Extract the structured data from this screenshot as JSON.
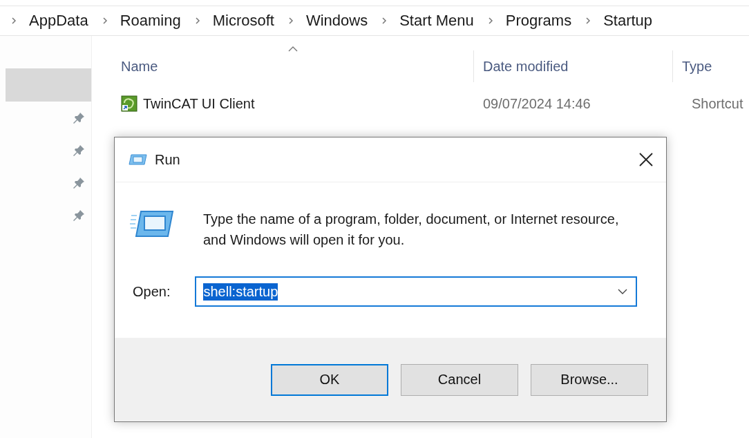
{
  "breadcrumb": [
    "AppData",
    "Roaming",
    "Microsoft",
    "Windows",
    "Start Menu",
    "Programs",
    "Startup"
  ],
  "sidebar": {
    "items": [
      {
        "selected": true,
        "pinned": false
      },
      {
        "selected": false,
        "pinned": true
      },
      {
        "selected": false,
        "pinned": true
      },
      {
        "selected": false,
        "pinned": true
      },
      {
        "selected": false,
        "pinned": true
      }
    ]
  },
  "file_list": {
    "columns": [
      {
        "label": "Name",
        "sorted": true
      },
      {
        "label": "Date modified",
        "sorted": false
      },
      {
        "label": "Type",
        "sorted": false
      }
    ],
    "rows": [
      {
        "name": "TwinCAT UI Client",
        "date_modified": "09/07/2024 14:46",
        "type": "Shortcut"
      }
    ]
  },
  "dialog": {
    "title": "Run",
    "message": "Type the name of a program, folder, document, or Internet resource, and Windows will open it for you.",
    "open_label": "Open:",
    "open_value": "shell:startup",
    "buttons": [
      {
        "label": "OK",
        "default": true
      },
      {
        "label": "Cancel",
        "default": false
      },
      {
        "label": "Browse...",
        "default": false
      }
    ]
  }
}
